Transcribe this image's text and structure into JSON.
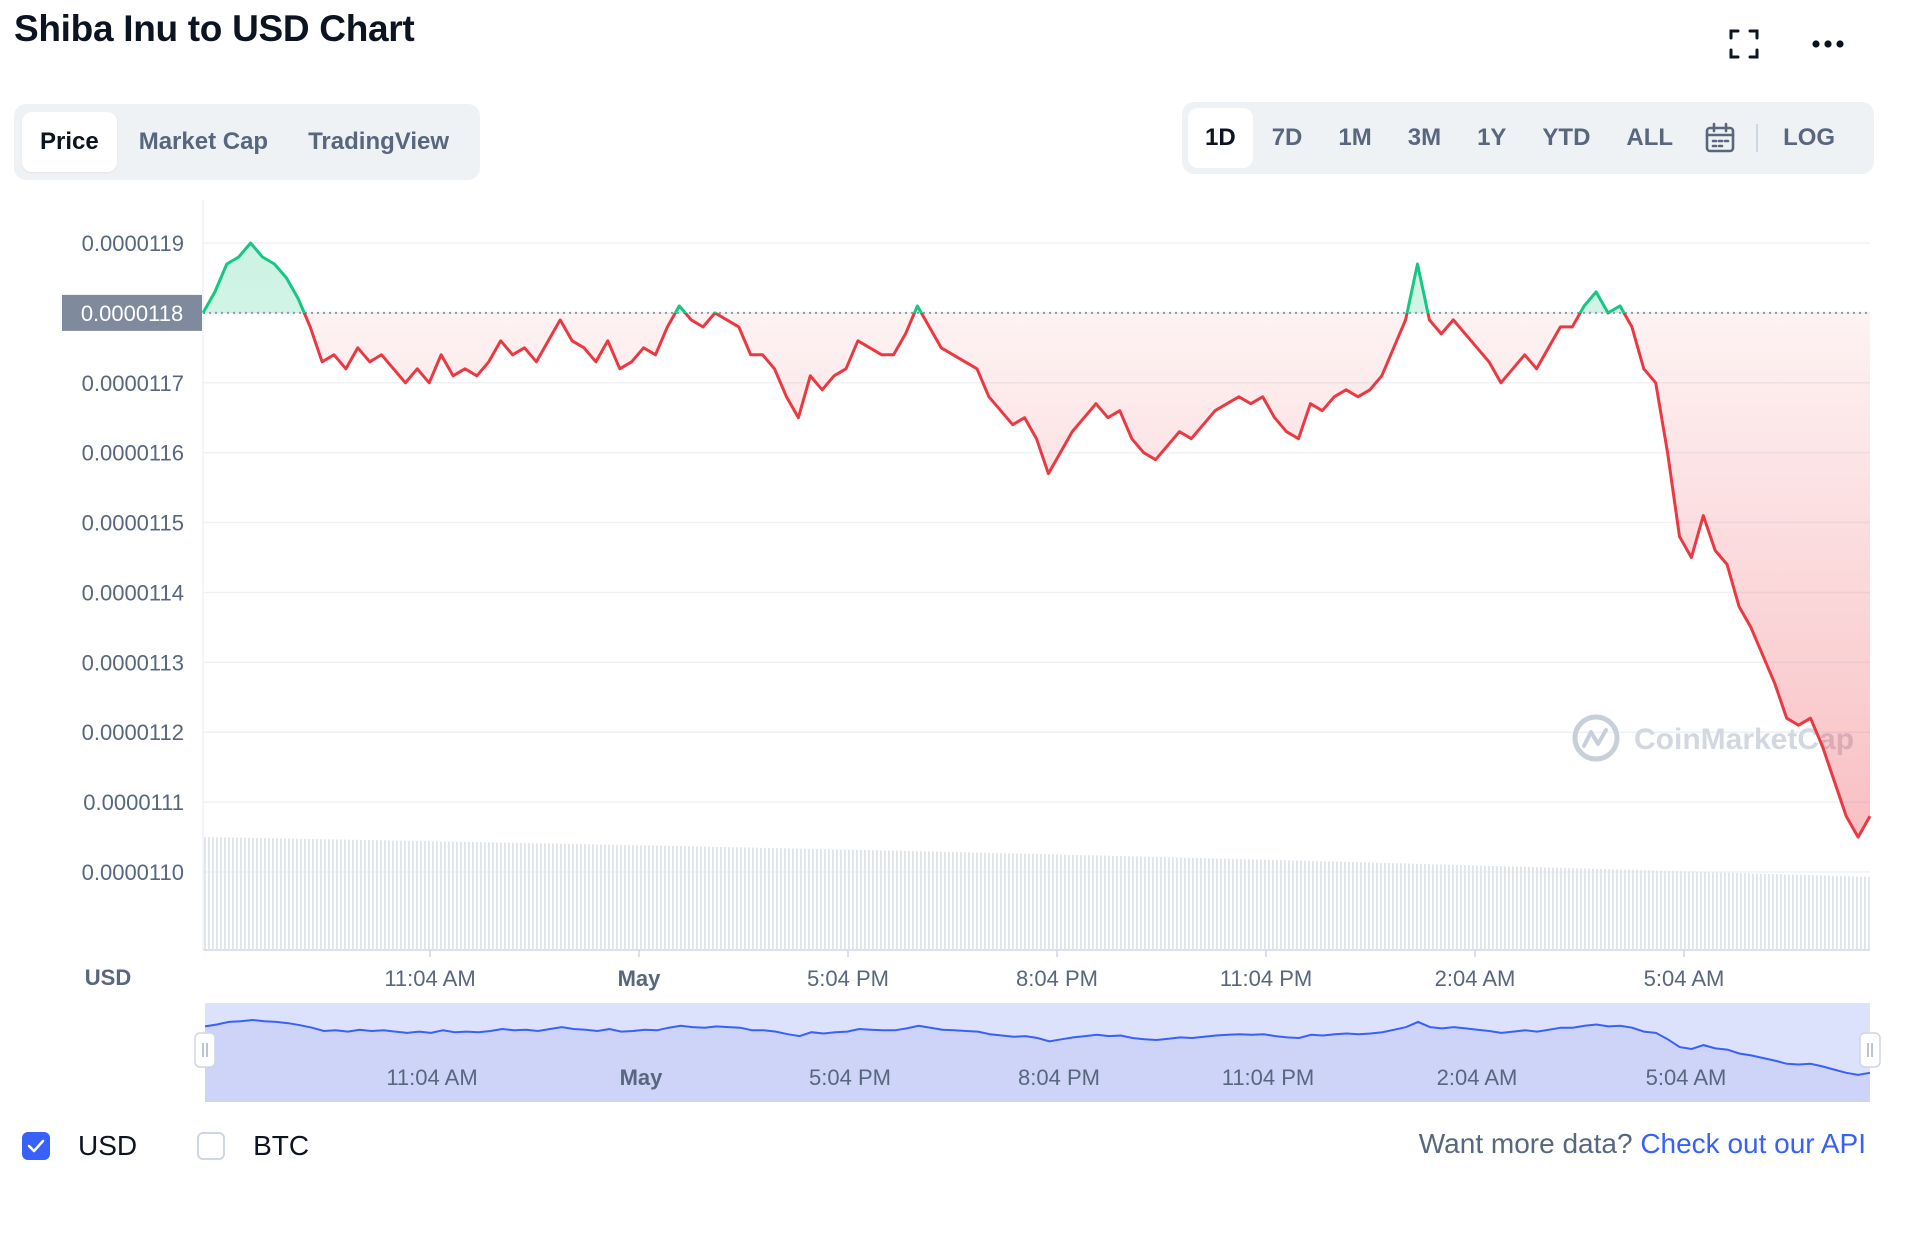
{
  "header": {
    "title": "Shiba Inu to USD Chart"
  },
  "tabs": [
    {
      "label": "Price",
      "active": true
    },
    {
      "label": "Market Cap",
      "active": false
    },
    {
      "label": "TradingView",
      "active": false
    }
  ],
  "ranges": [
    {
      "label": "1D",
      "active": true
    },
    {
      "label": "7D",
      "active": false
    },
    {
      "label": "1M",
      "active": false
    },
    {
      "label": "3M",
      "active": false
    },
    {
      "label": "1Y",
      "active": false
    },
    {
      "label": "YTD",
      "active": false
    },
    {
      "label": "ALL",
      "active": false
    }
  ],
  "log_label": "LOG",
  "icons": {
    "fullscreen": "fullscreen-icon",
    "more": "more-icon",
    "calendar": "calendar-icon"
  },
  "colors": {
    "up": "#16c784",
    "down": "#ea3943",
    "accent": "#3861fb",
    "navigator_fill": "#dde2fc"
  },
  "chart_data": {
    "type": "line",
    "currency_label": "USD",
    "watermark": "CoinMarketCap",
    "y_ticks": [
      "0.0000119",
      "0.0000118",
      "0.0000117",
      "0.0000116",
      "0.0000115",
      "0.0000114",
      "0.0000113",
      "0.0000112",
      "0.0000111",
      "0.0000110"
    ],
    "ylim": [
      1.1e-05,
      1.19e-05
    ],
    "reference_price": 1.18e-05,
    "current_price_label": "0.0000118",
    "x_ticks": [
      "11:04 AM",
      "May",
      "5:04 PM",
      "8:04 PM",
      "11:04 PM",
      "2:04 AM",
      "5:04 AM"
    ],
    "series": [
      {
        "values": [
          1.18e-05,
          1.183e-05,
          1.187e-05,
          1.188e-05,
          1.19e-05,
          1.188e-05,
          1.187e-05,
          1.185e-05,
          1.182e-05,
          1.178e-05,
          1.173e-05,
          1.174e-05,
          1.172e-05,
          1.175e-05,
          1.173e-05,
          1.174e-05,
          1.172e-05,
          1.17e-05,
          1.172e-05,
          1.17e-05,
          1.174e-05,
          1.171e-05,
          1.172e-05,
          1.171e-05,
          1.173e-05,
          1.176e-05,
          1.174e-05,
          1.175e-05,
          1.173e-05,
          1.176e-05,
          1.179e-05,
          1.176e-05,
          1.175e-05,
          1.173e-05,
          1.176e-05,
          1.172e-05,
          1.173e-05,
          1.175e-05,
          1.174e-05,
          1.178e-05,
          1.181e-05,
          1.179e-05,
          1.178e-05,
          1.18e-05,
          1.179e-05,
          1.178e-05,
          1.174e-05,
          1.174e-05,
          1.172e-05,
          1.168e-05,
          1.165e-05,
          1.171e-05,
          1.169e-05,
          1.171e-05,
          1.172e-05,
          1.176e-05,
          1.175e-05,
          1.174e-05,
          1.174e-05,
          1.177e-05,
          1.181e-05,
          1.178e-05,
          1.175e-05,
          1.174e-05,
          1.173e-05,
          1.172e-05,
          1.168e-05,
          1.166e-05,
          1.164e-05,
          1.165e-05,
          1.162e-05,
          1.157e-05,
          1.16e-05,
          1.163e-05,
          1.165e-05,
          1.167e-05,
          1.165e-05,
          1.166e-05,
          1.162e-05,
          1.16e-05,
          1.159e-05,
          1.161e-05,
          1.163e-05,
          1.162e-05,
          1.164e-05,
          1.166e-05,
          1.167e-05,
          1.168e-05,
          1.167e-05,
          1.168e-05,
          1.165e-05,
          1.163e-05,
          1.162e-05,
          1.167e-05,
          1.166e-05,
          1.168e-05,
          1.169e-05,
          1.168e-05,
          1.169e-05,
          1.171e-05,
          1.175e-05,
          1.179e-05,
          1.187e-05,
          1.179e-05,
          1.177e-05,
          1.179e-05,
          1.177e-05,
          1.175e-05,
          1.173e-05,
          1.17e-05,
          1.172e-05,
          1.174e-05,
          1.172e-05,
          1.175e-05,
          1.178e-05,
          1.178e-05,
          1.181e-05,
          1.183e-05,
          1.18e-05,
          1.181e-05,
          1.178e-05,
          1.172e-05,
          1.17e-05,
          1.16e-05,
          1.148e-05,
          1.145e-05,
          1.151e-05,
          1.146e-05,
          1.144e-05,
          1.138e-05,
          1.135e-05,
          1.131e-05,
          1.127e-05,
          1.122e-05,
          1.121e-05,
          1.122e-05,
          1.118e-05,
          1.113e-05,
          1.108e-05,
          1.105e-05,
          1.108e-05
        ]
      }
    ]
  },
  "legend": [
    {
      "label": "USD",
      "checked": true
    },
    {
      "label": "BTC",
      "checked": false
    }
  ],
  "footer": {
    "api_text": "Want more data?",
    "api_link": "Check out our API"
  }
}
